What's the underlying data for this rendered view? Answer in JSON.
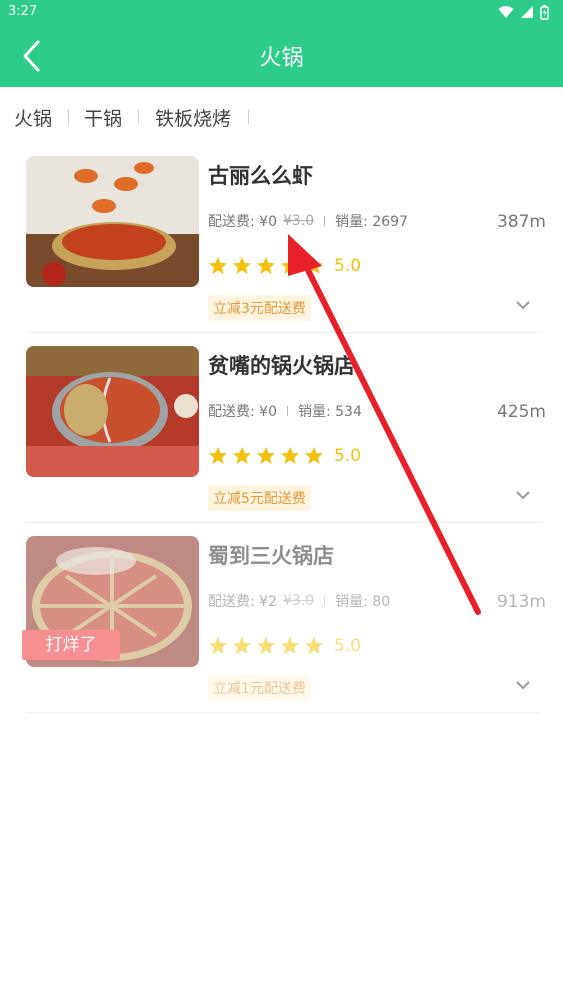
{
  "status_bar": {
    "time": "3:27"
  },
  "header": {
    "title": "火锅"
  },
  "tabs": [
    {
      "label": "火锅"
    },
    {
      "label": "干锅"
    },
    {
      "label": "铁板烧烤"
    }
  ],
  "shops": [
    {
      "name": "古丽么么虾",
      "delivery_label": "配送费: ¥0",
      "original_fee": "¥3.0",
      "sales_label": "销量: 2697",
      "distance": "387m",
      "rating": "5.0",
      "promo": "立减3元配送费"
    },
    {
      "name": "贫嘴的锅火锅店",
      "delivery_label": "配送费: ¥0",
      "sales_label": "销量: 534",
      "distance": "425m",
      "rating": "5.0",
      "promo": "立减5元配送费"
    },
    {
      "name": "蜀到三火锅店",
      "delivery_label": "配送费: ¥2",
      "original_fee": "¥3.0",
      "sales_label": "销量: 80",
      "distance": "913m",
      "rating": "5.0",
      "promo": "立减1元配送费",
      "closed_badge": "打烊了"
    }
  ],
  "colors": {
    "primary": "#2ecc8b",
    "star": "#f4c20d",
    "promo_bg": "#fff4df",
    "promo_text": "#e39a3a",
    "closed_badge": "#f58f92",
    "annotation_arrow": "#e8202a"
  }
}
